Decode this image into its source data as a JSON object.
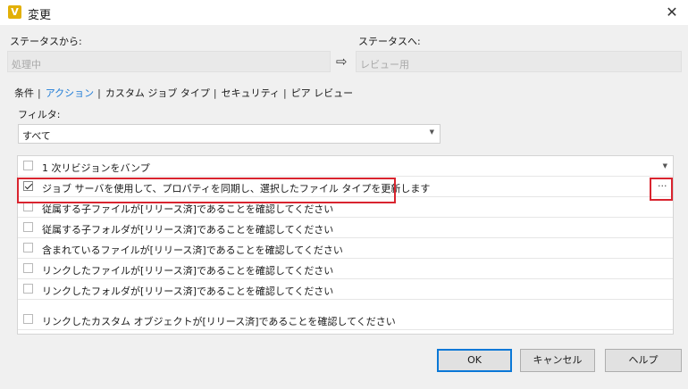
{
  "window": {
    "title": "変更",
    "app_icon": "V",
    "close": "✕"
  },
  "status": {
    "from_label": "ステータスから:",
    "from_value": "処理中",
    "arrow": "⇨",
    "to_label": "ステータスへ:",
    "to_value": "レビュー用"
  },
  "tabs": {
    "items": [
      "条件",
      "アクション",
      "カスタム ジョブ タイプ",
      "セキュリティ",
      "ピア レビュー"
    ],
    "separator": "|",
    "active": "アクション"
  },
  "filter": {
    "label": "フィルタ:",
    "value": "すべて"
  },
  "actions": [
    {
      "label": "1 次リビジョンをバンプ",
      "checked": false
    },
    {
      "label": "ジョブ サーバを使用して、プロパティを同期し、選択したファイル タイプを更新します",
      "checked": true,
      "more": "···"
    },
    {
      "label": "従属する子ファイルが[リリース済]であることを確認してください",
      "checked": false
    },
    {
      "label": "従属する子フォルダが[リリース済]であることを確認してください",
      "checked": false
    },
    {
      "label": "含まれているファイルが[リリース済]であることを確認してください",
      "checked": false
    },
    {
      "label": "リンクしたファイルが[リリース済]であることを確認してください",
      "checked": false
    },
    {
      "label": "リンクしたフォルダが[リリース済]であることを確認してください",
      "checked": false
    },
    {
      "label": "リンクしたカスタム オブジェクトが[リリース済]であることを確認してください",
      "checked": false
    }
  ],
  "buttons": {
    "ok": "OK",
    "cancel": "キャンセル",
    "help": "ヘルプ"
  },
  "colors": {
    "accent": "#1e7bd6",
    "highlight_border": "#d9242f",
    "app_icon": "#e2b007"
  }
}
